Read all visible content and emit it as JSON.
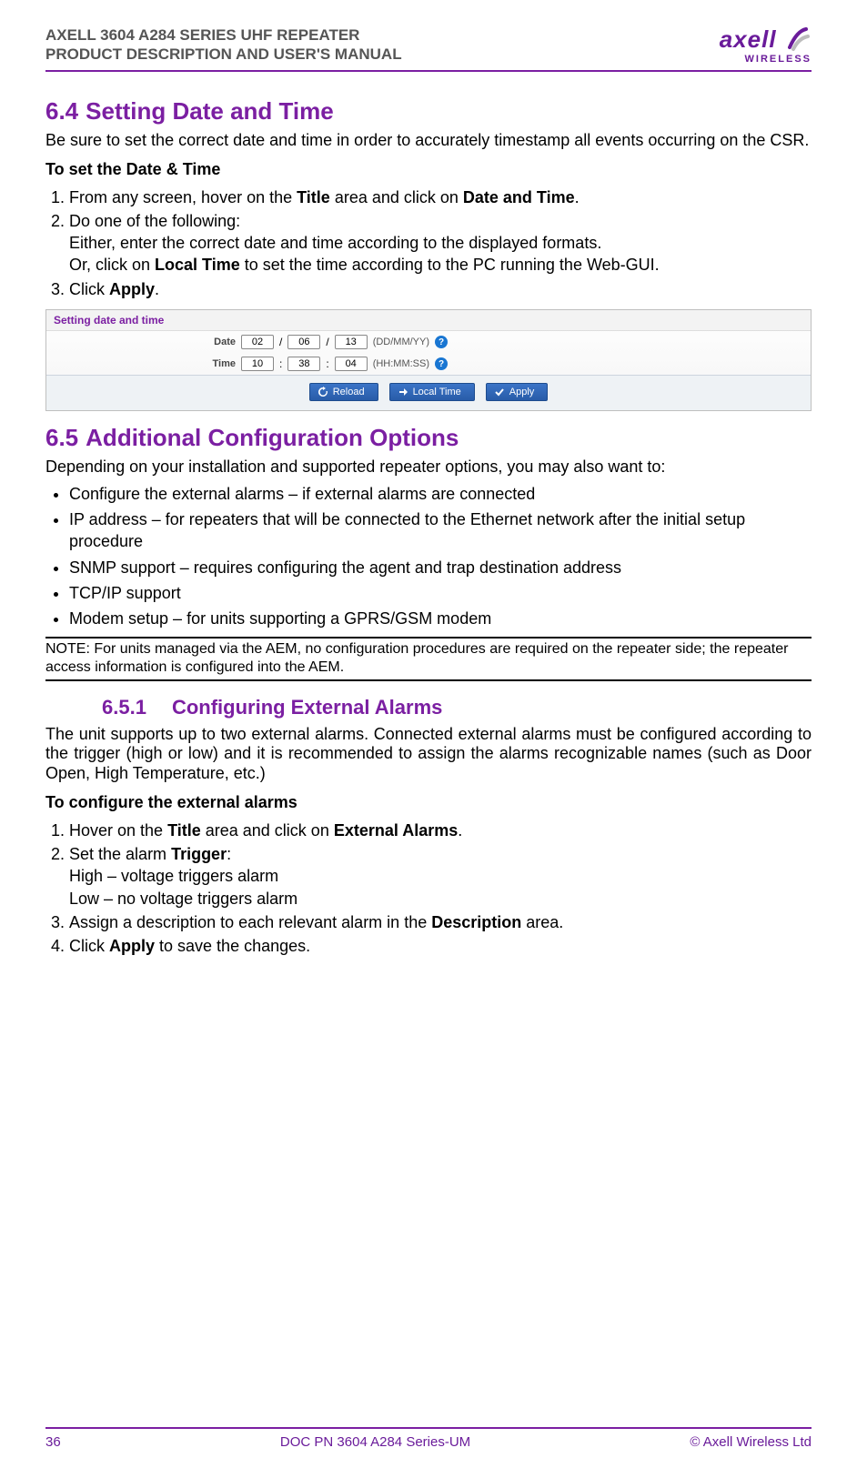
{
  "header": {
    "line1": "AXELL 3604 A284 SERIES UHF REPEATER",
    "line2": "PRODUCT DESCRIPTION AND USER'S MANUAL",
    "logo_word": "axell",
    "logo_sub": "WIRELESS"
  },
  "section64": {
    "num": "6.4",
    "title": "Setting Date and Time",
    "intro": "Be sure to set the correct date and time in order to accurately timestamp all events occurring on the CSR.",
    "subhead": "To set the Date & Time",
    "step1_pre": "From any screen, hover on the ",
    "step1_bold1": "Title",
    "step1_mid": " area and click on ",
    "step1_bold2": "Date and Time",
    "step1_post": ".",
    "step2": "Do one of the following:",
    "step2a": "Either, enter the correct date and time according to the displayed formats.",
    "step2b_pre": "Or, click on ",
    "step2b_bold": "Local Time",
    "step2b_post": " to set the time according to the PC running the Web-GUI.",
    "step3_pre": "Click ",
    "step3_bold": "Apply",
    "step3_post": "."
  },
  "panel": {
    "title": "Setting date and time",
    "date_label": "Date",
    "date_dd": "02",
    "date_mm": "06",
    "date_yy": "13",
    "date_fmt": "(DD/MM/YY)",
    "time_label": "Time",
    "time_hh": "10",
    "time_mm": "38",
    "time_ss": "04",
    "time_fmt": "(HH:MM:SS)",
    "btn_reload": "Reload",
    "btn_local": "Local Time",
    "btn_apply": "Apply"
  },
  "section65": {
    "num": "6.5",
    "title": "Additional Configuration Options",
    "intro": "Depending on your installation and supported repeater options, you may also want to:",
    "b1": "Configure the external alarms – if external alarms are connected",
    "b2": "IP address – for repeaters that will be connected to the Ethernet network after the initial setup procedure",
    "b3": "SNMP support – requires configuring the agent and trap destination address",
    "b4": "TCP/IP support",
    "b5": "Modem setup – for units supporting a GPRS/GSM modem",
    "note": "NOTE: For units managed via the AEM, no configuration procedures are required on the repeater side; the repeater access information is configured into the AEM."
  },
  "section651": {
    "num": "6.5.1",
    "title": "Configuring External Alarms",
    "intro": "The unit supports up to two external alarms. Connected external alarms must be configured according to the trigger (high or low) and it is recommended to assign the alarms recognizable names (such as Door Open, High Temperature, etc.)",
    "subhead": "To configure the external alarms",
    "s1_pre": "Hover on the ",
    "s1_b1": "Title",
    "s1_mid": " area and click on ",
    "s1_b2": "External Alarms",
    "s1_post": ".",
    "s2_pre": "Set the alarm ",
    "s2_b": "Trigger",
    "s2_post": ":",
    "s2a": "High – voltage triggers alarm",
    "s2b": "Low – no voltage triggers alarm",
    "s3_pre": "Assign a description to each relevant alarm in the ",
    "s3_b": "Description",
    "s3_post": " area.",
    "s4_pre": "Click ",
    "s4_b": "Apply",
    "s4_post": " to save the changes."
  },
  "footer": {
    "left": "36",
    "center": "DOC PN 3604 A284 Series-UM",
    "right": "© Axell Wireless Ltd"
  }
}
